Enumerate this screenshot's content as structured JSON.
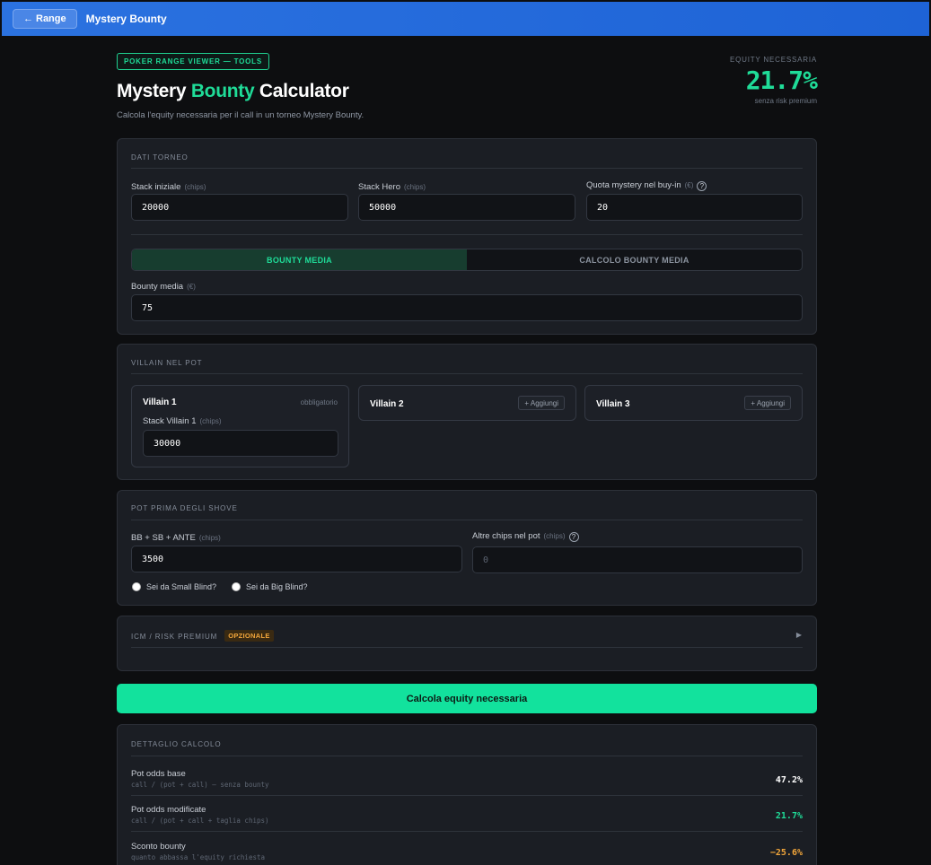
{
  "topbar": {
    "back_label": "Range",
    "back_arrow": "←",
    "title": "Mystery Bounty"
  },
  "header": {
    "badge": "POKER RANGE VIEWER — TOOLS",
    "title_pre": "Mystery ",
    "title_accent": "Bounty",
    "title_post": " Calculator",
    "subtitle": "Calcola l'equity necessaria per il call in un torneo Mystery Bounty."
  },
  "equity": {
    "label": "EQUITY NECESSARIA",
    "value": "21.7%",
    "note": "senza risk premium"
  },
  "tournament": {
    "title": "DATI TORNEO",
    "stack_initial": {
      "label": "Stack iniziale",
      "unit": "(chips)",
      "value": "20000"
    },
    "stack_hero": {
      "label": "Stack Hero",
      "unit": "(chips)",
      "value": "50000"
    },
    "mystery_quota": {
      "label": "Quota mystery nel buy-in",
      "unit": "(€)",
      "value": "20"
    },
    "toggle": {
      "option_a": "BOUNTY MEDIA",
      "option_b": "CALCOLO BOUNTY MEDIA",
      "active": "option_a"
    },
    "bounty_avg": {
      "label": "Bounty media",
      "unit": "(€)",
      "value": "75"
    }
  },
  "villains": {
    "title": "VILLAIN NEL POT",
    "v1": {
      "name": "Villain 1",
      "required": "obbligatorio",
      "stack_label": "Stack Villain 1",
      "unit": "(chips)",
      "value": "30000"
    },
    "v2": {
      "name": "Villain 2",
      "add_label": "+ Aggiungi"
    },
    "v3": {
      "name": "Villain 3",
      "add_label": "+ Aggiungi"
    }
  },
  "pot": {
    "title": "POT PRIMA DEGLI SHOVE",
    "blinds": {
      "label": "BB + SB + ANTE",
      "unit": "(chips)",
      "value": "3500"
    },
    "other": {
      "label": "Altre chips nel pot",
      "unit": "(chips)",
      "placeholder": "0"
    },
    "radio_sb": "Sei da Small Blind?",
    "radio_bb": "Sei da Big Blind?"
  },
  "icm": {
    "title": "ICM / RISK PREMIUM",
    "badge": "OPZIONALE",
    "chevron": "▶"
  },
  "calc_button": "Calcola equity necessaria",
  "detail": {
    "title": "DETTAGLIO CALCOLO",
    "rows": [
      {
        "label": "Pot odds base",
        "sub": "call / (pot + call) — senza bounty",
        "value": "47.2%",
        "color": "#ffffff"
      },
      {
        "label": "Pot odds modificate",
        "sub": "call / (pot + call + taglia chips)",
        "value": "21.7%",
        "color": "#1fdc98"
      },
      {
        "label": "Sconto bounty",
        "sub": "quanto abbassa l'equity richiesta",
        "value": "−25.6%",
        "color": "#f1a53a"
      }
    ]
  }
}
